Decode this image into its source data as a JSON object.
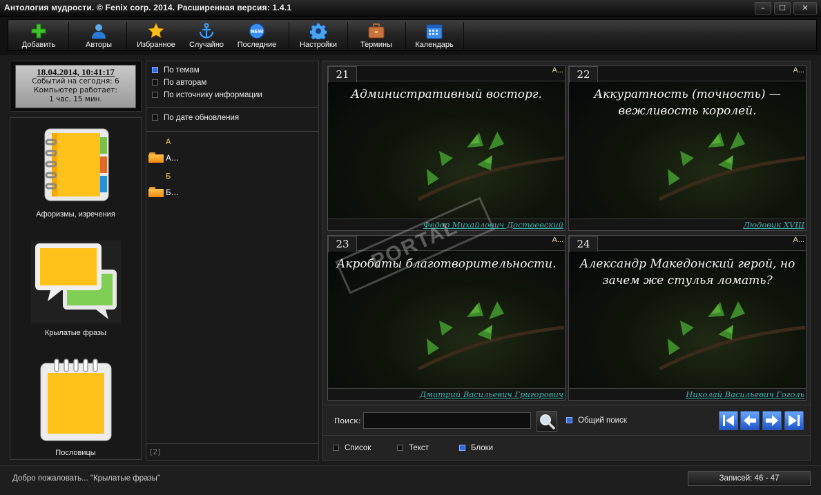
{
  "window": {
    "title": "Антология мудрости. © Fenix corp. 2014. Расширенная версия: 1.4.1",
    "minimize": "–",
    "maximize": "☐",
    "close": "✕"
  },
  "toolbar": {
    "items": [
      {
        "label": "Добавить",
        "icon": "plus-icon"
      },
      {
        "label": "Авторы",
        "icon": "user-icon"
      },
      {
        "label": "Избранное",
        "icon": "star-icon"
      },
      {
        "label": "Случайно",
        "icon": "anchor-icon"
      },
      {
        "label": "Последние",
        "icon": "new-badge-icon"
      },
      {
        "label": "Настройки",
        "icon": "gear-icon"
      },
      {
        "label": "Термины",
        "icon": "briefcase-icon"
      },
      {
        "label": "Календарь",
        "icon": "calendar-icon"
      }
    ]
  },
  "clock": {
    "datetime": "18.04.2014, 10:41:17",
    "events_today": "Событий на сегодня: 6",
    "uptime_label": "Компьютер работает:",
    "uptime_value": "1 час. 15 мин."
  },
  "categories": [
    {
      "label": "Афоризмы, изречения",
      "icon": "notebook-icon"
    },
    {
      "label": "Крылатые фразы",
      "icon": "speech-bubbles-icon"
    },
    {
      "label": "Пословицы",
      "icon": "notepad-icon"
    }
  ],
  "tree": {
    "sort_options": [
      {
        "label": "По темам",
        "checked": true
      },
      {
        "label": "По авторам",
        "checked": false
      },
      {
        "label": "По источнику информации",
        "checked": false
      }
    ],
    "date_option": {
      "label": "По дате обновления",
      "checked": false
    },
    "groups": [
      {
        "letter": "А",
        "folder": "А..."
      },
      {
        "letter": "Б",
        "folder": "Б..."
      }
    ],
    "page_indicator": "[2]"
  },
  "cards": [
    {
      "number": "21",
      "category": "А...",
      "quote": "Административный восторг.",
      "author": "Федор Михайлович Достоевский"
    },
    {
      "number": "22",
      "category": "А...",
      "quote": "Аккуратность (точность) — вежливость королей.",
      "author": "Людовик XVIII"
    },
    {
      "number": "23",
      "category": "А...",
      "quote": "Акробаты благотворительности.",
      "author": "Дмитрий Васильевич Григорович"
    },
    {
      "number": "24",
      "category": "А...",
      "quote": "Александр Македонский герой, но зачем же стулья ломать?",
      "author": "Николай Васильевич Гоголь"
    }
  ],
  "search": {
    "label": "Поиск:",
    "value": "",
    "global_label": "Общий поиск",
    "global_checked": true
  },
  "view": {
    "options": [
      {
        "label": "Список",
        "checked": false
      },
      {
        "label": "Текст",
        "checked": false
      },
      {
        "label": "Блоки",
        "checked": true
      }
    ]
  },
  "status": {
    "message": "Добро пожаловать... \"Крылатые фразы\"",
    "records": "Записей: 46 - 47"
  },
  "watermark": "PORTAL",
  "colors": {
    "accent": "#2f6be0",
    "author_link": "#3fb6b0",
    "letter": "#f2c64a"
  }
}
